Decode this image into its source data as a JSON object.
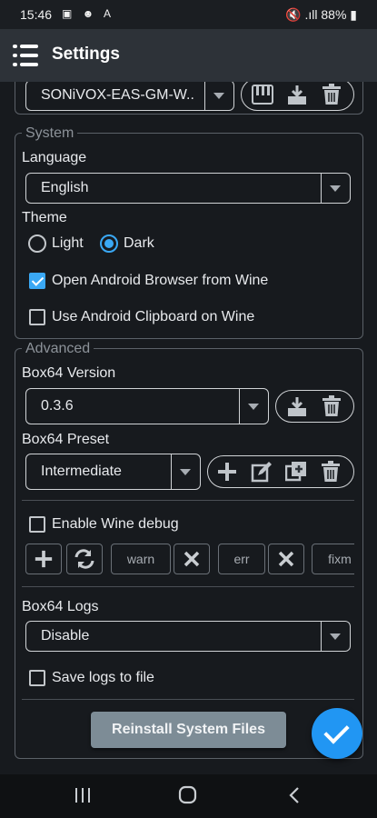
{
  "status_bar": {
    "time": "15:46",
    "notification_icons": "▣ ☻ A",
    "right_icons": "🔇 .ıll",
    "battery": "88%"
  },
  "app_bar": {
    "title": "Settings",
    "menu_icon": "hamburger-menu-icon"
  },
  "top_row": {
    "soundfont_value": "SONiVOX-EAS-GM-W.."
  },
  "system": {
    "legend": "System",
    "language_label": "Language",
    "language_value": "English",
    "theme_label": "Theme",
    "theme_options": [
      "Light",
      "Dark"
    ],
    "theme_selected": "Dark",
    "open_browser_label": "Open Android Browser from Wine",
    "open_browser_checked": true,
    "clipboard_label": "Use Android Clipboard on Wine",
    "clipboard_checked": false
  },
  "advanced": {
    "legend": "Advanced",
    "box64_version_label": "Box64 Version",
    "box64_version_value": "0.3.6",
    "box64_preset_label": "Box64 Preset",
    "box64_preset_value": "Intermediate",
    "wine_debug_label": "Enable Wine debug",
    "wine_debug_checked": false,
    "debug_chips": [
      "warn",
      "err",
      "fixm"
    ],
    "box64_logs_label": "Box64 Logs",
    "box64_logs_value": "Disable",
    "save_logs_label": "Save logs to file",
    "save_logs_checked": false
  },
  "reinstall_button": "Reinstall System Files",
  "colors": {
    "accent": "#2196f3",
    "appbar": "#2d3238",
    "background": "#171a1e"
  }
}
